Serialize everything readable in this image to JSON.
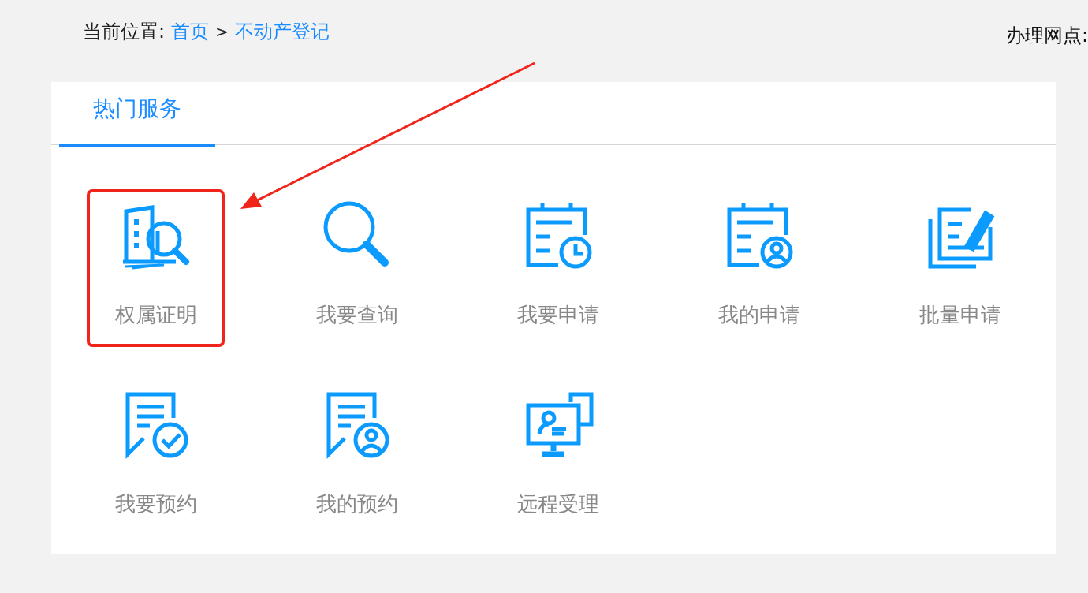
{
  "breadcrumb": {
    "label": "当前位置:",
    "links": [
      "首页",
      "不动产登记"
    ],
    "separator": ">"
  },
  "outlet": {
    "label": "办理网点:"
  },
  "tabs": [
    {
      "label": "热门服务",
      "selected": true
    }
  ],
  "services": [
    {
      "label": "权属证明",
      "kind": "building-search",
      "highlighted": true
    },
    {
      "label": "我要查询",
      "kind": "search",
      "highlighted": false
    },
    {
      "label": "我要申请",
      "kind": "calendar-clock",
      "highlighted": false
    },
    {
      "label": "我的申请",
      "kind": "calendar-user",
      "highlighted": false
    },
    {
      "label": "批量申请",
      "kind": "batch-edit",
      "highlighted": false
    },
    {
      "label": "我要预约",
      "kind": "note-check",
      "highlighted": false
    },
    {
      "label": "我的预约",
      "kind": "note-user",
      "highlighted": false
    },
    {
      "label": "远程受理",
      "kind": "remote",
      "highlighted": false
    }
  ],
  "annotation": {
    "kind": "arrow"
  }
}
